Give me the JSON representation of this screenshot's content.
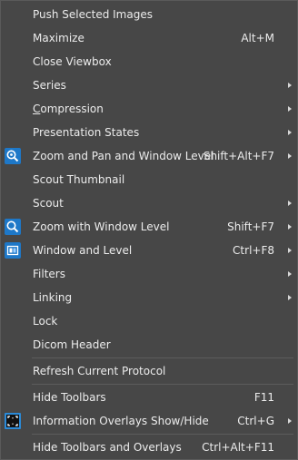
{
  "menu": {
    "items": [
      {
        "label": "Push Selected Images",
        "shortcut": "",
        "submenu": false,
        "icon": null
      },
      {
        "label": "Maximize",
        "shortcut": "Alt+M",
        "submenu": false,
        "icon": null
      },
      {
        "label": "Close Viewbox",
        "shortcut": "",
        "submenu": false,
        "icon": null
      },
      {
        "label": "Series",
        "shortcut": "",
        "submenu": true,
        "icon": null
      },
      {
        "label": "Compression",
        "shortcut": "",
        "submenu": true,
        "icon": null,
        "accel": "C"
      },
      {
        "label": "Presentation States",
        "shortcut": "",
        "submenu": true,
        "icon": null
      },
      {
        "label": "Zoom and Pan and Window Level",
        "shortcut": "Shift+Alt+F7",
        "submenu": true,
        "icon": "zoom-pan-icon"
      },
      {
        "label": "Scout Thumbnail",
        "shortcut": "",
        "submenu": false,
        "icon": null
      },
      {
        "label": "Scout",
        "shortcut": "",
        "submenu": true,
        "icon": null
      },
      {
        "label": "Zoom with Window Level",
        "shortcut": "Shift+F7",
        "submenu": true,
        "icon": "zoom-window-level-icon"
      },
      {
        "label": "Window and Level",
        "shortcut": "Ctrl+F8",
        "submenu": true,
        "icon": "window-level-icon"
      },
      {
        "label": "Filters",
        "shortcut": "",
        "submenu": true,
        "icon": null
      },
      {
        "label": "Linking",
        "shortcut": "",
        "submenu": true,
        "icon": null
      },
      {
        "label": "Lock",
        "shortcut": "",
        "submenu": false,
        "icon": null
      },
      {
        "label": "Dicom Header",
        "shortcut": "",
        "submenu": false,
        "icon": null
      },
      {
        "label": "Refresh Current Protocol",
        "shortcut": "",
        "submenu": false,
        "icon": null
      },
      {
        "label": "Hide Toolbars",
        "shortcut": "F11",
        "submenu": false,
        "icon": null
      },
      {
        "label": "Information Overlays Show/Hide",
        "shortcut": "Ctrl+G",
        "submenu": true,
        "icon": "information-overlays-icon"
      },
      {
        "label": "Hide Toolbars and Overlays",
        "shortcut": "Ctrl+Alt+F11",
        "submenu": false,
        "icon": null
      }
    ]
  },
  "colors": {
    "background": "#474747",
    "text": "#ececec",
    "separator": "#5c5c5c",
    "icon_accent": "#1e78c8"
  }
}
